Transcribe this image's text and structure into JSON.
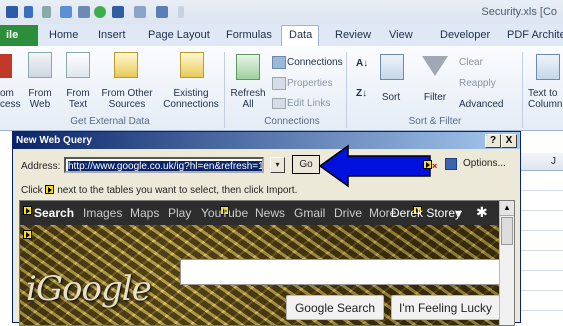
{
  "window": {
    "title": "Security.xls  [Co"
  },
  "tabs": [
    {
      "label": "ile"
    },
    {
      "label": "Home"
    },
    {
      "label": "Insert"
    },
    {
      "label": "Page Layout"
    },
    {
      "label": "Formulas"
    },
    {
      "label": "Data"
    },
    {
      "label": "Review"
    },
    {
      "label": "View"
    },
    {
      "label": "Developer"
    },
    {
      "label": "PDF Architect"
    }
  ],
  "ribbon": {
    "from_access": "om\ncess",
    "from_web": "From\nWeb",
    "from_text": "From\nText",
    "from_other": "From Other\nSources",
    "existing_connections": "Existing\nConnections",
    "refresh_all": "Refresh\nAll",
    "connections": "Connections",
    "properties": "Properties",
    "edit_links": "Edit Links",
    "sort": "Sort",
    "filter": "Filter",
    "clear": "Clear",
    "reapply": "Reapply",
    "advanced": "Advanced",
    "text_to_columns": "Text to\nColumn",
    "group_external": "Get External Data",
    "group_connections": "Connections",
    "group_sort": "Sort & Filter",
    "dropdown_arrow": "▾"
  },
  "dialog": {
    "title": "New Web Query",
    "help_btn": "?",
    "close_btn": "X",
    "address_label": "Address:",
    "address_value": "http://www.google.co.uk/ig?hl=en&refresh=1",
    "go_label": "Go",
    "options_label": "Options...",
    "hint": "next to the tables you want to select, then click Import.",
    "hint_prefix": "Click"
  },
  "webpage": {
    "nav": [
      "Search",
      "Images",
      "Maps",
      "Play",
      "YouTube",
      "News",
      "Gmail",
      "Drive",
      "More"
    ],
    "user": "Derek Storey",
    "brand": "iGoogle",
    "buttons": [
      "Google Search",
      "I'm Feeling Lucky"
    ]
  },
  "grid": {
    "col_j": "J"
  }
}
